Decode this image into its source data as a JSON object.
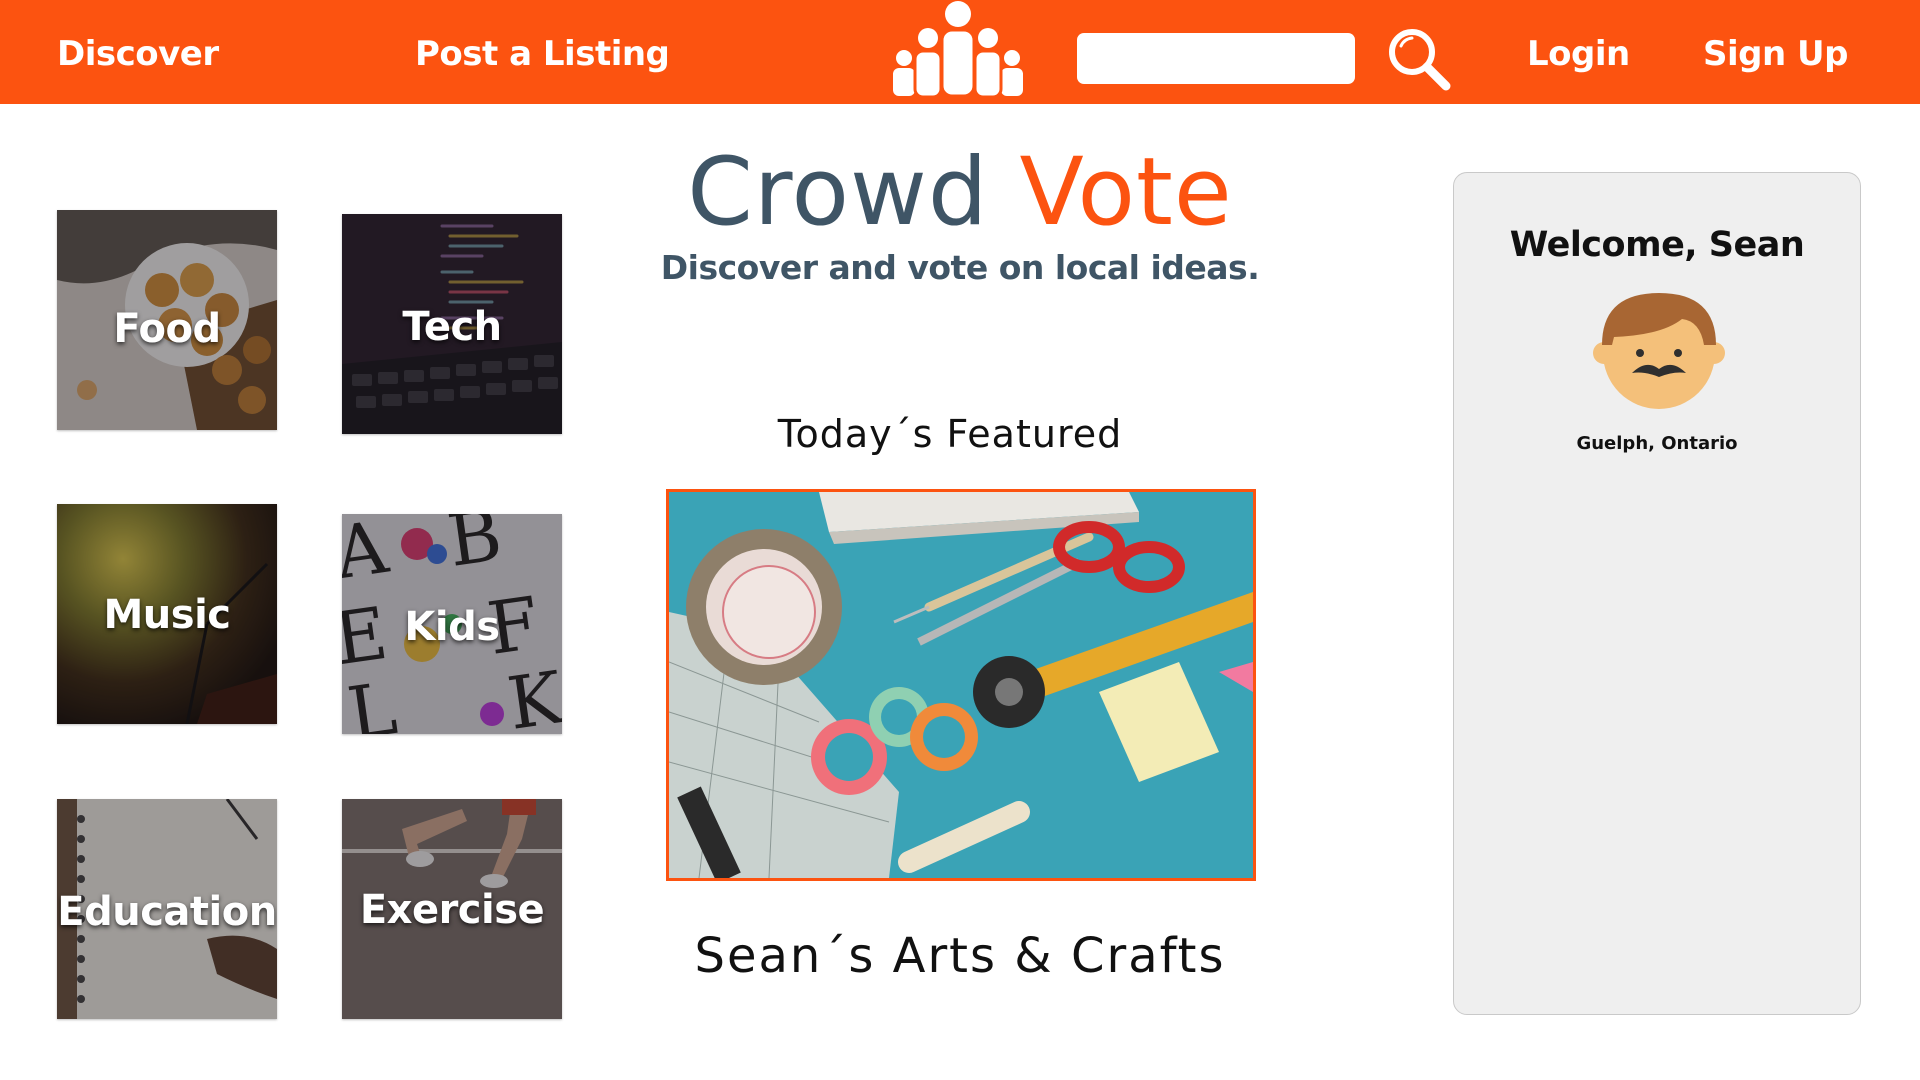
{
  "nav": {
    "discover": "Discover",
    "post_listing": "Post a Listing",
    "login": "Login",
    "signup": "Sign Up"
  },
  "search": {
    "placeholder": "",
    "value": ""
  },
  "categories": [
    {
      "label": "Food"
    },
    {
      "label": "Tech"
    },
    {
      "label": "Music"
    },
    {
      "label": "Kids"
    },
    {
      "label": "Education"
    },
    {
      "label": "Exercise"
    }
  ],
  "hero": {
    "title_part1": "Crowd",
    "title_part2": "Vote",
    "tagline": "Discover and vote on local ideas."
  },
  "featured": {
    "heading": "Today´s Featured",
    "title": "Sean´s Arts & Crafts"
  },
  "profile": {
    "welcome": "Welcome, Sean",
    "location": "Guelph, Ontario"
  },
  "icons": {
    "logo": "crowd-people-icon",
    "search": "magnifier-icon",
    "avatar": "mustache-man-avatar"
  },
  "colors": {
    "brand_orange": "#fc5310",
    "title_slate": "#3f5566",
    "panel_bg": "#efefef"
  }
}
